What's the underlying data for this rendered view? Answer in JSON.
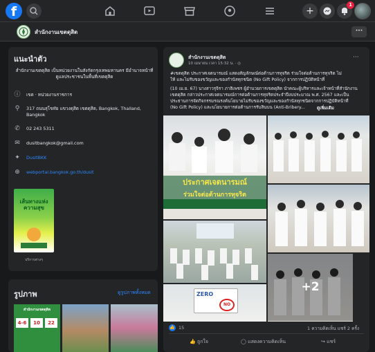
{
  "topbar": {
    "logo": "f",
    "notification_count": "1"
  },
  "page": {
    "name": "สำนักงานเขตดุสิต",
    "more_label": "···"
  },
  "intro": {
    "title": "แนะนำตัว",
    "description": "สำนักงานเขตดุสิต เป็นหน่วยงานในสังกัดกรุงเทพมหานคร มีอำนาจหน้าที่ดูแลประชาชนในพื้นที่เขตดุสิต",
    "category": "เขต · หน่วยงานราชการ",
    "address": "317 ถนนสุโขทัย แขวงดุสิต เขตดุสิต, Bangkok, Thailand, Bangkok",
    "phone": "02 243 5311",
    "email": "dusitbangkok@gmail.com",
    "twitter": "DusitBKK",
    "website": "webportal.bangkok.go.th/dusit",
    "promo_text": "เส้นทางแห่ง ความสุข",
    "promo_caption": "บริการต่างๆ"
  },
  "photos": {
    "title": "รูปภาพ",
    "see_all": "ดูรูปภาพทั้งหมด",
    "thumb1_title": "สำนักงานเขตดุสิต",
    "thumb1_numbers": [
      "4-6",
      "10",
      "22"
    ]
  },
  "post": {
    "author": "สำนักงานเขตดุสิต",
    "timestamp": "10 เมษายน เวลา 15:32 น. · ◎",
    "text_line1": "#เขตดุสิต ประกาศเจตนารมณ์ แสดงสัญลักษณ์ต่อต้านการทุจริต ร่วมใจต่อต้านการทุจริต ไม่",
    "text_line2": "ให้ และไม่รับของขวัญและของกำนัลทุกชนิด (No Gift Policy) จากการปฏิบัติหน้าที่",
    "text_line3": "(10 เม.ย. 67) นางสาวรุจิรา ภาธิเพชร ผู้อำนวยการเขตดุสิต นำคณะผู้บริหารและเจ้าหน้าที่สำนักงาน",
    "text_line4": "เขตดุสิต กล่าวประกาศเจตนารมณ์การต่อต้านการทุจริตประจำปีงบประมาณ พ.ศ. 2567 และเป็น",
    "text_line5": "ประธานการจัดกิจกรรมรณรงค์นโยบายไม่รับของขวัญและของกำนัลทุกชนิดจากการปฏิบัติหน้าที่",
    "text_line6": "(No Gift Policy) และนโยบายการต่อต้านการรับสินบน (Anti-Bribery...",
    "see_more": "ดูเพิ่มเติม",
    "banner_line1": "ประกาศเจตนารมณ์",
    "banner_line2": "ร่วมใจต่อต้านการทุจริต",
    "zero_text": "ZERO",
    "no_text": "NO",
    "more_photos": "+2",
    "reactions": "15",
    "comments_shares": "1 ความคิดเห็น  แชร์ 2 ครั้ง",
    "like_label": "ถูกใจ",
    "comment_label": "แสดงความคิดเห็น",
    "share_label": "แชร์"
  }
}
